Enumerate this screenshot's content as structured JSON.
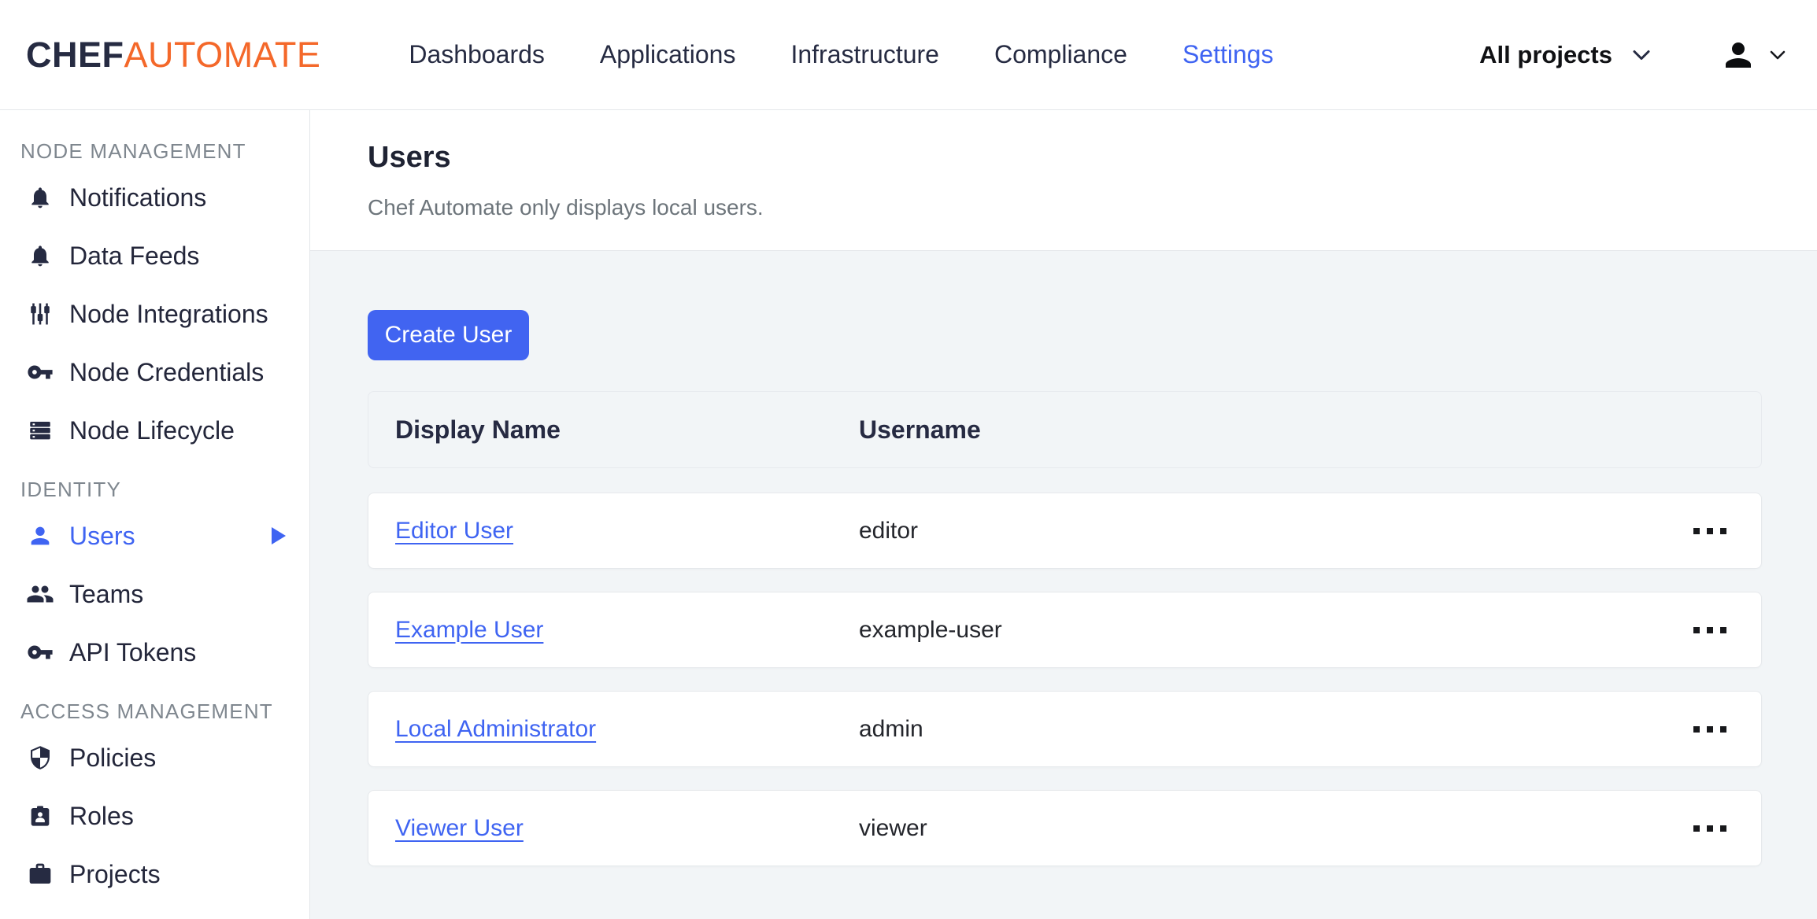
{
  "colors": {
    "accent_blue": "#3f64f2",
    "brand_navy": "#262b42",
    "brand_orange": "#f4682a",
    "page_bg": "#f2f5f7",
    "card_bg": "#ffffff",
    "card_border": "#e6e9ec",
    "text_dark": "#24262c",
    "text_gray": "#6d757b",
    "section_gray": "#7f878f"
  },
  "header": {
    "logo_chef": "CHEF",
    "logo_automate": "AUTOMATE",
    "nav": [
      {
        "label": "Dashboards",
        "active": false
      },
      {
        "label": "Applications",
        "active": false
      },
      {
        "label": "Infrastructure",
        "active": false
      },
      {
        "label": "Compliance",
        "active": false
      },
      {
        "label": "Settings",
        "active": true
      }
    ],
    "projects_dropdown": {
      "label": "All projects",
      "icon": "chevron-down-icon"
    },
    "user_menu": {
      "icon": "person-icon",
      "chevron": "chevron-down-icon"
    }
  },
  "sidebar": {
    "sections": [
      {
        "title": "NODE MANAGEMENT",
        "items": [
          {
            "label": "Notifications",
            "icon": "bell-icon",
            "active": false
          },
          {
            "label": "Data Feeds",
            "icon": "bell-icon",
            "active": false
          },
          {
            "label": "Node Integrations",
            "icon": "sliders-icon",
            "active": false
          },
          {
            "label": "Node Credentials",
            "icon": "key-icon",
            "active": false
          },
          {
            "label": "Node Lifecycle",
            "icon": "server-stack-icon",
            "active": false
          }
        ]
      },
      {
        "title": "IDENTITY",
        "items": [
          {
            "label": "Users",
            "icon": "person-icon",
            "active": true,
            "has_arrow": true
          },
          {
            "label": "Teams",
            "icon": "people-icon",
            "active": false
          },
          {
            "label": "API Tokens",
            "icon": "key-icon",
            "active": false
          }
        ]
      },
      {
        "title": "ACCESS MANAGEMENT",
        "items": [
          {
            "label": "Policies",
            "icon": "shield-icon",
            "active": false
          },
          {
            "label": "Roles",
            "icon": "badge-icon",
            "active": false
          },
          {
            "label": "Projects",
            "icon": "briefcase-icon",
            "active": false
          }
        ]
      }
    ]
  },
  "main": {
    "title": "Users",
    "subtitle": "Chef Automate only displays local users.",
    "create_button_label": "Create User",
    "table": {
      "columns": [
        "Display Name",
        "Username"
      ],
      "rows": [
        {
          "display_name": "Editor User",
          "username": "editor"
        },
        {
          "display_name": "Example User",
          "username": "example-user"
        },
        {
          "display_name": "Local Administrator",
          "username": "admin"
        },
        {
          "display_name": "Viewer User",
          "username": "viewer"
        }
      ]
    }
  }
}
